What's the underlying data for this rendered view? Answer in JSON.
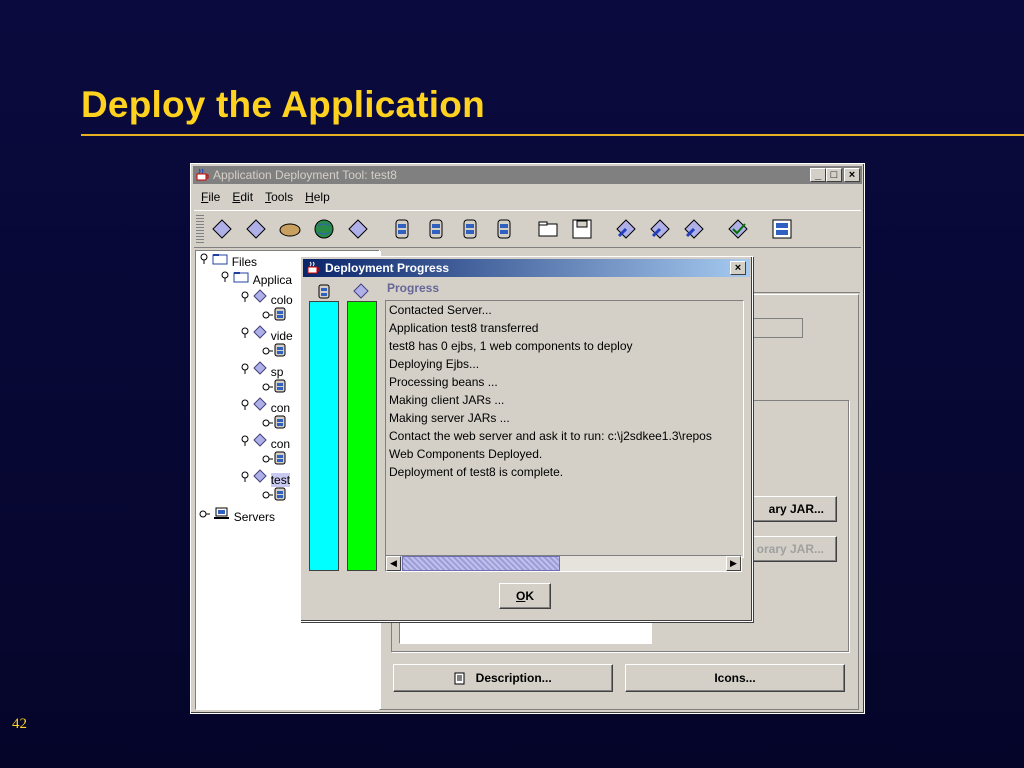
{
  "slide": {
    "title": "Deploy the Application",
    "page_number": "42"
  },
  "app_window": {
    "title": "Application Deployment Tool: test8",
    "menus": [
      "File",
      "Edit",
      "Tools",
      "Help"
    ],
    "menu_mnemonics": [
      "F",
      "E",
      "T",
      "H"
    ],
    "toolbar_icons": [
      "new-application-icon",
      "new-ejb-icon",
      "new-client-icon",
      "new-web-component-icon",
      "new-connector-icon",
      "add-entity-icon",
      "add-ejb-jar-icon",
      "add-session-icon",
      "add-client-jar-icon",
      "open-folder-icon",
      "save-icon",
      "update-files-icon",
      "deploy-icon",
      "undeploy-icon",
      "verify-icon",
      "server-config-icon"
    ],
    "tree": {
      "files": "Files",
      "applications": "Applica",
      "apps": [
        "colo",
        "vide",
        "sp",
        "con",
        "con",
        "test"
      ],
      "servers": "Servers"
    },
    "buttons": {
      "add_library_jar": "ary JAR...",
      "remove_library_jar": "orary JAR...",
      "description": "Description...",
      "icons": "Icons..."
    }
  },
  "progress_dialog": {
    "title": "Deployment Progress",
    "progress_label": "Progress",
    "log_lines": [
      "Contacted Server...",
      "Application test8 transferred",
      "test8 has 0  ejbs, 1 web components to deploy",
      "Deploying Ejbs...",
      "Processing beans ...",
      "Making client JARs ...",
      "Making server JARs ...",
      "Contact the web server and ask it to run: c:\\j2sdkee1.3\\repos",
      "Web Components Deployed.",
      "Deployment of test8 is complete."
    ],
    "ok_label": "OK",
    "ok_mnemonic": "O",
    "bar_colors": {
      "server": "#00ffff",
      "application": "#00ff00"
    }
  }
}
